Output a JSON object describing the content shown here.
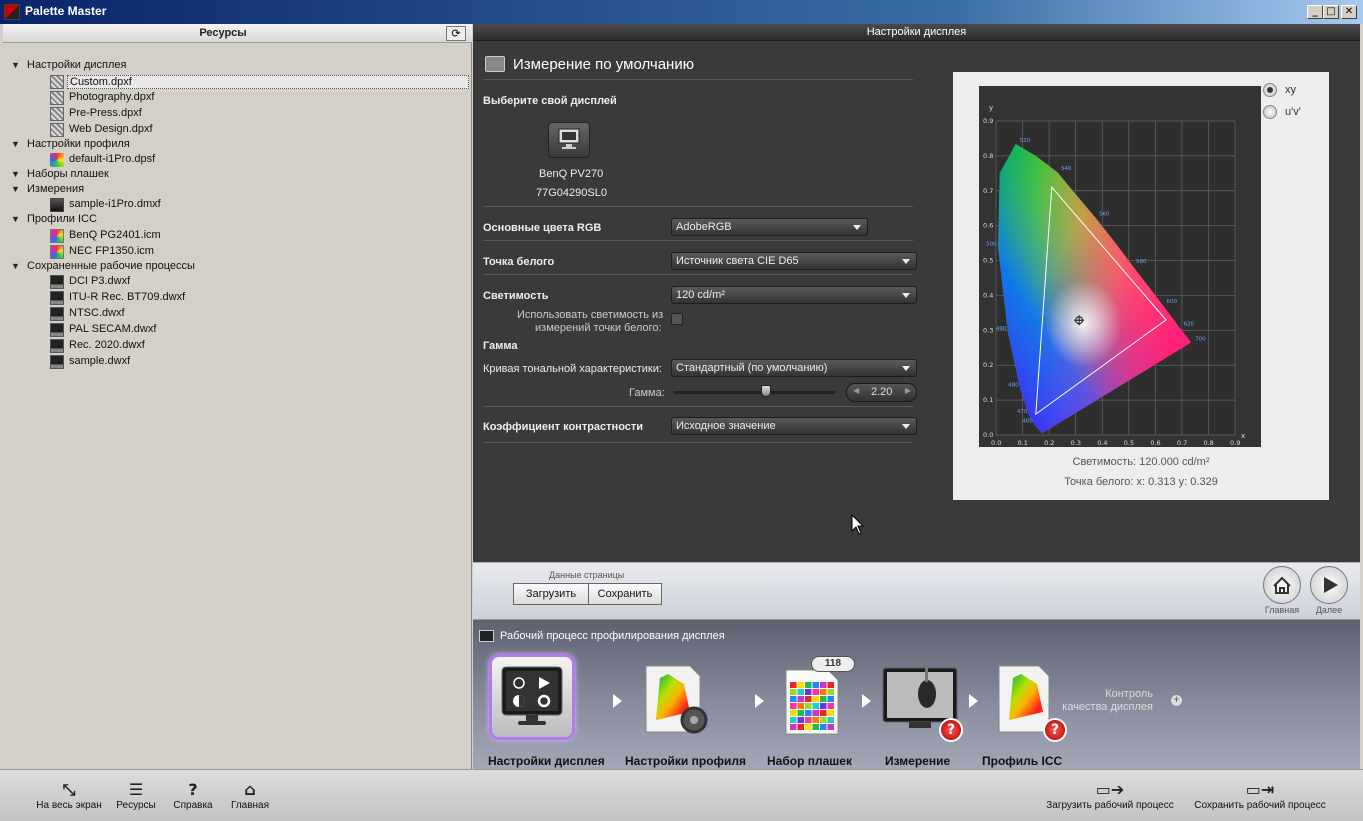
{
  "window": {
    "title": "Palette Master"
  },
  "left_panel": {
    "title": "Ресурсы",
    "tree": [
      {
        "label": "Настройки дисплея",
        "children": [
          "Custom.dpxf",
          "Photography.dpxf",
          "Pre-Press.dpxf",
          "Web Design.dpxf"
        ]
      },
      {
        "label": "Настройки профиля",
        "children": [
          "default-i1Pro.dpsf"
        ]
      },
      {
        "label": "Наборы плашек",
        "children": []
      },
      {
        "label": "Измерения",
        "children": [
          "sample-i1Pro.dmxf"
        ]
      },
      {
        "label": "Профили ICC",
        "children": [
          "BenQ PG2401.icm",
          "NEC FP1350.icm"
        ]
      },
      {
        "label": "Сохраненные рабочие процессы",
        "children": [
          "DCI P3.dwxf",
          "ITU-R Rec. BT709.dwxf",
          "NTSC.dwxf",
          "PAL SECAM.dwxf",
          "Rec. 2020.dwxf",
          "sample.dwxf"
        ]
      }
    ]
  },
  "main": {
    "header": "Настройки дисплея",
    "title": "Измерение по умолчанию",
    "choose_display": "Выберите свой дисплей",
    "display_name": "BenQ PV270",
    "display_serial": "77G04290SL0",
    "rgb_label": "Основные цвета RGB",
    "rgb_value": "AdobeRGB",
    "white_label": "Точка белого",
    "white_value": "Источник света CIE D65",
    "lum_label": "Светимость",
    "lum_value": "120 cd/m²",
    "use_lum_line1": "Использовать светимость из",
    "use_lum_line2": "измерений точки белого:",
    "gamma_section": "Гамма",
    "tone_curve_label": "Кривая тональной характеристики:",
    "tone_curve_value": "Стандартный (по умолчанию)",
    "gamma_label": "Гамма:",
    "gamma_value": "2.20",
    "contrast_label": "Коэффициент контрастности",
    "contrast_value": "Исходное значение"
  },
  "chart_panel": {
    "mode_xy": "xy",
    "mode_uv": "u'v'",
    "y_axis_label": "y",
    "x_axis_label": "x",
    "ticks": [
      "0.0",
      "0.1",
      "0.2",
      "0.3",
      "0.4",
      "0.5",
      "0.6",
      "0.7",
      "0.8",
      "0.9"
    ],
    "luminance_text": "Светимость: 120.000 cd/m²",
    "whitepoint_text": "Точка белого: x: 0.313  y: 0.329"
  },
  "chart_data": {
    "type": "scatter",
    "x_label": "x",
    "y_label": "y",
    "xlim": [
      0,
      0.9
    ],
    "ylim": [
      0,
      0.9
    ],
    "gamut_triangle": [
      [
        0.64,
        0.33
      ],
      [
        0.21,
        0.71
      ],
      [
        0.15,
        0.06
      ]
    ],
    "white_point": [
      0.313,
      0.329
    ],
    "spectral_locus_labels": [
      {
        "nm": "520",
        "x": 0.074,
        "y": 0.834
      },
      {
        "nm": "540",
        "x": 0.23,
        "y": 0.754
      },
      {
        "nm": "560",
        "x": 0.373,
        "y": 0.624
      },
      {
        "nm": "580",
        "x": 0.512,
        "y": 0.487
      },
      {
        "nm": "600",
        "x": 0.627,
        "y": 0.373
      },
      {
        "nm": "620",
        "x": 0.691,
        "y": 0.308
      },
      {
        "nm": "700",
        "x": 0.735,
        "y": 0.265
      },
      {
        "nm": "500",
        "x": 0.008,
        "y": 0.538
      },
      {
        "nm": "490",
        "x": 0.045,
        "y": 0.295
      },
      {
        "nm": "480",
        "x": 0.091,
        "y": 0.133
      },
      {
        "nm": "470",
        "x": 0.124,
        "y": 0.058
      },
      {
        "nm": "460",
        "x": 0.144,
        "y": 0.03
      }
    ]
  },
  "page_data": {
    "label": "Данные страницы",
    "load": "Загрузить",
    "save": "Сохранить",
    "home": "Главная",
    "next": "Далее"
  },
  "workflow": {
    "title": "Рабочий процесс профилирования дисплея",
    "steps": [
      "Настройки дисплея",
      "Настройки профиля",
      "Набор плашек",
      "Измерение",
      "Профиль ICC"
    ],
    "patch_count": "118",
    "qc_line1": "Контроль",
    "qc_line2": "качества дисплея"
  },
  "toolbar": {
    "fullscreen": "На весь экран",
    "resources": "Ресурсы",
    "help": "Справка",
    "home": "Главная",
    "load_workflow": "Загрузить рабочий процесс",
    "save_workflow": "Сохранить рабочий процесс"
  }
}
